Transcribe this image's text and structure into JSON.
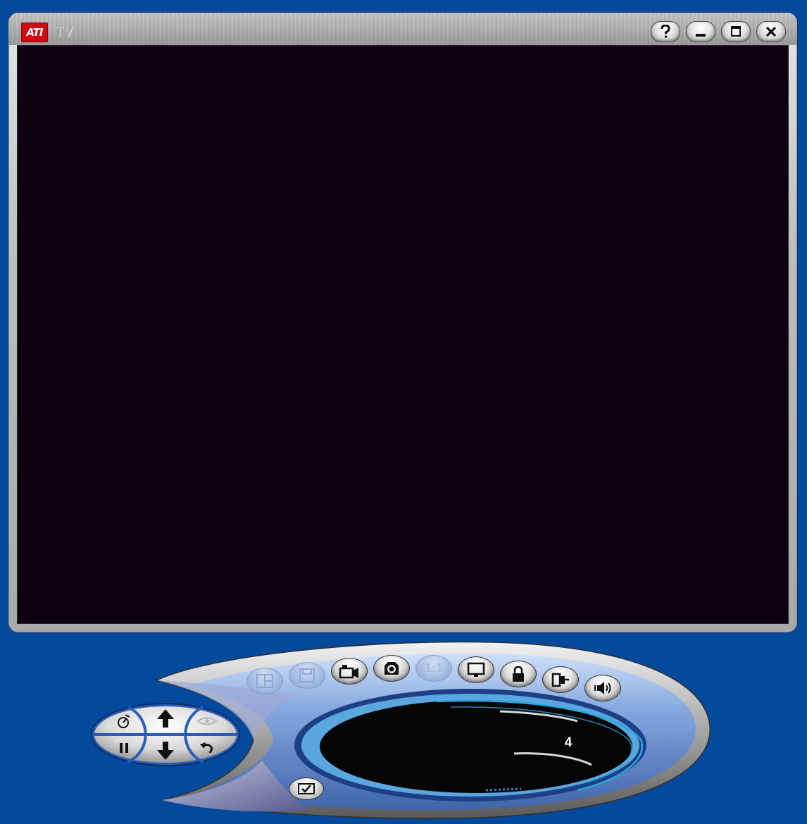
{
  "window": {
    "logo_text": "ATI",
    "title": "TV",
    "buttons": {
      "help": "help-icon",
      "minimize": "minimize-icon",
      "maximize": "maximize-icon",
      "close": "close-icon"
    }
  },
  "video": {
    "background": "#0e0010"
  },
  "control_panel": {
    "toolbar": [
      {
        "name": "layout-icon",
        "enabled": false
      },
      {
        "name": "save-icon",
        "enabled": false
      },
      {
        "name": "record-icon",
        "enabled": true
      },
      {
        "name": "snapshot-icon",
        "enabled": true
      },
      {
        "name": "zoom-1-1",
        "enabled": false,
        "label": "1:1"
      },
      {
        "name": "display-icon",
        "enabled": true
      },
      {
        "name": "lock-icon",
        "enabled": true
      },
      {
        "name": "compact-icon",
        "enabled": true
      },
      {
        "name": "volume-icon",
        "enabled": true
      }
    ],
    "dpad": {
      "up": "arrow-up-icon",
      "down": "arrow-down-icon",
      "timer": "timer-icon",
      "pause": "pause-icon",
      "eye": "eye-icon",
      "back": "undo-icon"
    },
    "channel": "4",
    "tasks": "checkbox-icon"
  },
  "colors": {
    "desktop": "#034a9c",
    "panel_blue": "#6f95d6",
    "display_black": "#050505",
    "accent_cyan": "#27a7e0"
  }
}
